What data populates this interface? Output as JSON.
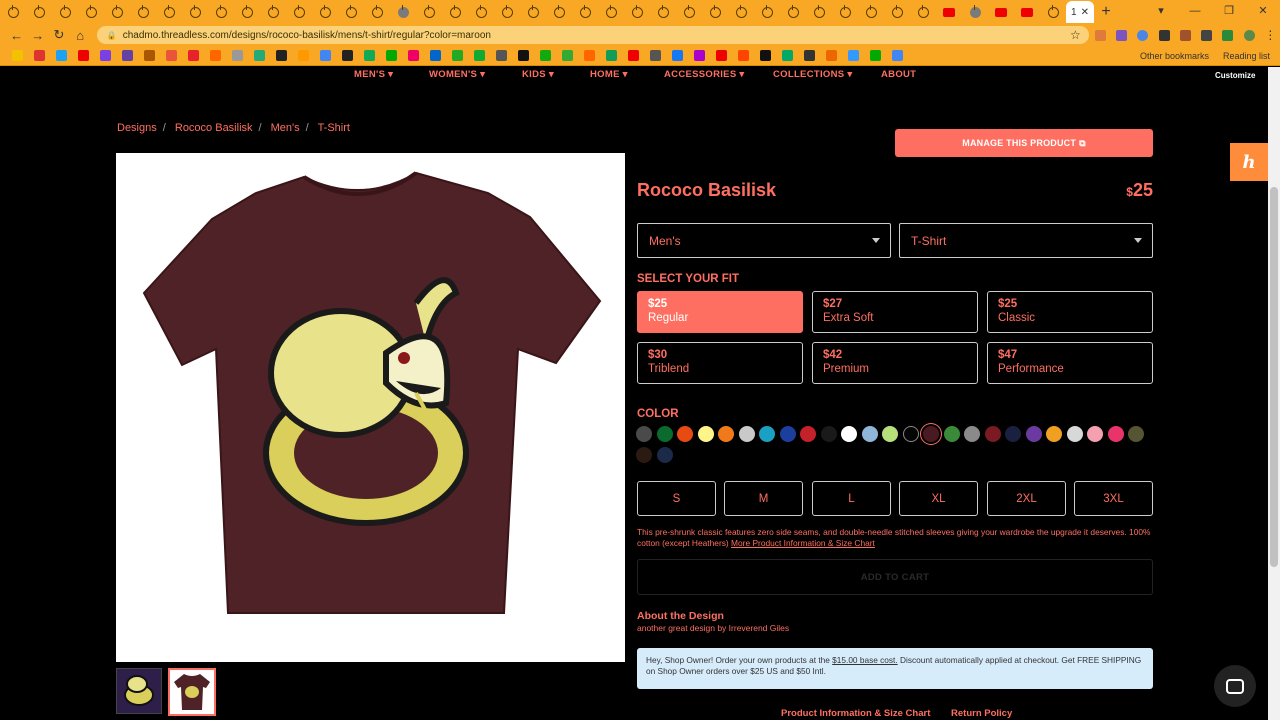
{
  "browser": {
    "url": "chadmo.threadless.com/designs/rococo-basilisk/mens/t-shirt/regular?color=maroon",
    "active_tab_label": "1",
    "active_tab_close": "✕",
    "new_tab": "+",
    "bookmarks_right": [
      "Other bookmarks",
      "Reading list"
    ]
  },
  "nav": {
    "items": [
      "MEN'S",
      "WOMEN'S",
      "KIDS",
      "HOME",
      "ACCESSORIES",
      "COLLECTIONS",
      "ABOUT"
    ],
    "customize": "Customize"
  },
  "breadcrumb": [
    "Designs",
    "Rococo Basilisk",
    "Men's",
    "T-Shirt"
  ],
  "manage_button": "MANAGE THIS PRODUCT",
  "product": {
    "title": "Rococo Basilisk",
    "price_currency": "$",
    "price": "25",
    "gender_select": "Men's",
    "style_select": "T-Shirt"
  },
  "fit": {
    "label": "SELECT YOUR FIT",
    "options": [
      {
        "price": "$25",
        "name": "Regular",
        "selected": true
      },
      {
        "price": "$27",
        "name": "Extra Soft",
        "selected": false
      },
      {
        "price": "$25",
        "name": "Classic",
        "selected": false
      },
      {
        "price": "$30",
        "name": "Triblend",
        "selected": false
      },
      {
        "price": "$42",
        "name": "Premium",
        "selected": false
      },
      {
        "price": "$47",
        "name": "Performance",
        "selected": false
      }
    ]
  },
  "color": {
    "label": "COLOR",
    "swatches": [
      "#4a4a4a",
      "#0b6b2e",
      "#e84a14",
      "#fff48a",
      "#f07a1a",
      "#c9c9c9",
      "#1aa0c2",
      "#1c3f9e",
      "#c4222a",
      "#1a1a1a",
      "#ffffff",
      "#8fb6d8",
      "#b6e07a",
      "#050505",
      "#4a1a22",
      "#3a8a3a",
      "#8a8a8a",
      "#7a1a22",
      "#1a2040",
      "#6a3aa0",
      "#f0a020",
      "#d8d8d8",
      "#f5a0b0",
      "#e8346a",
      "#555533",
      "#2a1a12",
      "#1a2a48"
    ],
    "selected_index": 14
  },
  "sizes": [
    "S",
    "M",
    "L",
    "XL",
    "2XL",
    "3XL"
  ],
  "description": {
    "text": "This pre-shrunk classic features zero side seams, and double-needle stitched sleeves giving your wardrobe the upgrade it deserves. 100% cotton (except Heathers)",
    "link": "More Product Information & Size Chart"
  },
  "add_to_cart": "ADD TO CART",
  "about": {
    "heading": "About the Design",
    "text": "another great design by Irreverend Giles"
  },
  "notice": {
    "before": "Hey, Shop Owner! Order your own products at the",
    "link": "$15.00 base cost.",
    "after": "Discount automatically applied at checkout. Get FREE SHIPPING on Shop Owner orders over $25 US and $50 Intl."
  },
  "footer_links": [
    "Product Information & Size Chart",
    "Return Policy"
  ],
  "colors": {
    "accent": "#ff6f61",
    "chrome": "#f9a825",
    "shirt": "#4e2226",
    "design_yellow": "#d9cf5a"
  }
}
